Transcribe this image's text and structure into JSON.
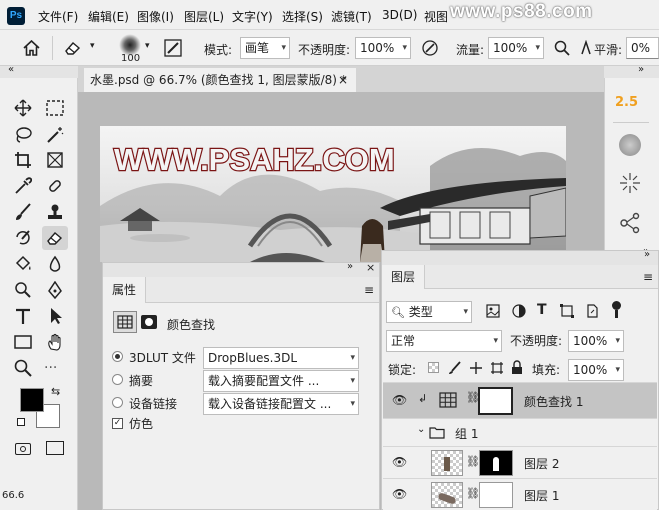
{
  "app": {
    "logo": "Ps"
  },
  "menu": [
    "文件(F)",
    "编辑(E)",
    "图像(I)",
    "图层(L)",
    "文字(Y)",
    "选择(S)",
    "滤镜(T)",
    "3D(D)",
    "视图"
  ],
  "watermark": "www.ps88.com",
  "options": {
    "brush_size": "100",
    "mode_label": "模式:",
    "mode_value": "画笔",
    "opacity_label": "不透明度:",
    "opacity_value": "100%",
    "flow_label": "流量:",
    "flow_value": "100%",
    "smooth_label": "平滑:",
    "smooth_value": "0%"
  },
  "document": {
    "tab_title": "水墨.psd @ 66.7% (颜色查找 1, 图层蒙版/8) *",
    "close": "×",
    "canvas_text": "WWW.PSAHZ.COM",
    "zoom_status": "66.6"
  },
  "right_strip": {
    "value": "2.5"
  },
  "properties": {
    "tab": "属性",
    "title": "颜色查找",
    "options": [
      {
        "label": "3DLUT 文件",
        "selected": true,
        "value": "DropBlues.3DL"
      },
      {
        "label": "摘要",
        "selected": false,
        "value": "载入摘要配置文件 ..."
      },
      {
        "label": "设备链接",
        "selected": false,
        "value": "载入设备链接配置文 ..."
      }
    ],
    "dither_label": "仿色",
    "dither_checked": true
  },
  "layers": {
    "tab": "图层",
    "filter_label": "类型",
    "blend_mode": "正常",
    "opacity_label": "不透明度:",
    "opacity_value": "100%",
    "lock_label": "锁定:",
    "fill_label": "填充:",
    "fill_value": "100%",
    "items": [
      {
        "name": "颜色查找 1",
        "kind": "adjustment",
        "selected": true
      },
      {
        "name": "组 1",
        "kind": "group",
        "selected": false
      },
      {
        "name": "图层 2",
        "kind": "layer",
        "selected": false
      },
      {
        "name": "图层 1",
        "kind": "layer",
        "selected": false
      }
    ]
  },
  "colors": {
    "accent_orange": "#f0a020",
    "foreground": "#000000",
    "background": "#ffffff",
    "selected_layer": "#c4c4c4"
  }
}
